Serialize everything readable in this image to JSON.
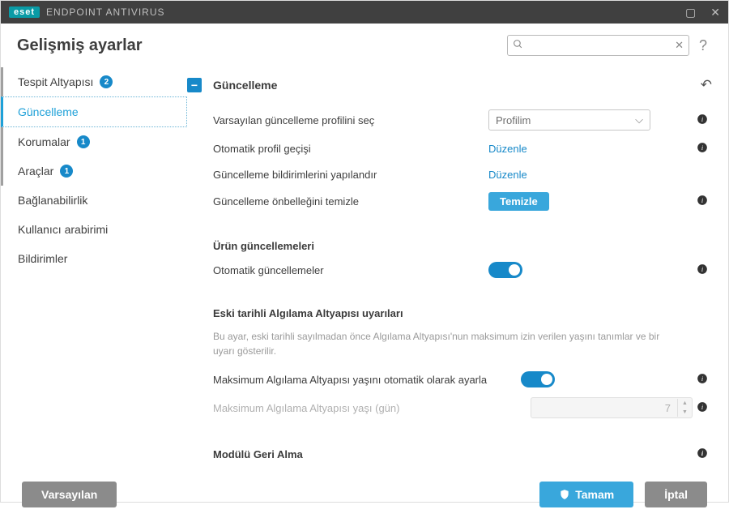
{
  "titlebar": {
    "brand": "eset",
    "product": "ENDPOINT ANTIVIRUS"
  },
  "header": {
    "title": "Gelişmiş ayarlar",
    "search_placeholder": "",
    "help": "?"
  },
  "sidebar": {
    "items": [
      {
        "label": "Tespit Altyapısı",
        "badge": "2"
      },
      {
        "label": "Güncelleme"
      },
      {
        "label": "Korumalar",
        "badge": "1"
      },
      {
        "label": "Araçlar",
        "badge": "1"
      },
      {
        "label": "Bağlanabilirlik"
      },
      {
        "label": "Kullanıcı arabirimi"
      },
      {
        "label": "Bildirimler"
      }
    ]
  },
  "section": {
    "title": "Güncelleme",
    "rows": {
      "profile": {
        "label": "Varsayılan güncelleme profilini seç",
        "value": "Profilim"
      },
      "autoprof": {
        "label": "Otomatik profil geçişi",
        "link": "Düzenle"
      },
      "notify": {
        "label": "Güncelleme bildirimlerini yapılandır",
        "link": "Düzenle"
      },
      "clear": {
        "label": "Güncelleme önbelleğini temizle",
        "button": "Temizle"
      }
    },
    "product_updates": {
      "heading": "Ürün güncellemeleri",
      "auto_label": "Otomatik güncellemeler"
    },
    "engine_age": {
      "heading": "Eski tarihli Algılama Altyapısı uyarıları",
      "desc": "Bu ayar, eski tarihli sayılmadan önce Algılama Altyapısı'nun maksimum izin verilen yaşını tanımlar ve bir uyarı gösterilir.",
      "auto_label": "Maksimum Algılama Altyapısı yaşını otomatik olarak ayarla",
      "days_label": "Maksimum Algılama Altyapısı yaşı (gün)",
      "days_value": "7"
    },
    "rollback": {
      "heading": "Modülü Geri Alma"
    }
  },
  "footer": {
    "default": "Varsayılan",
    "ok": "Tamam",
    "cancel": "İptal"
  }
}
